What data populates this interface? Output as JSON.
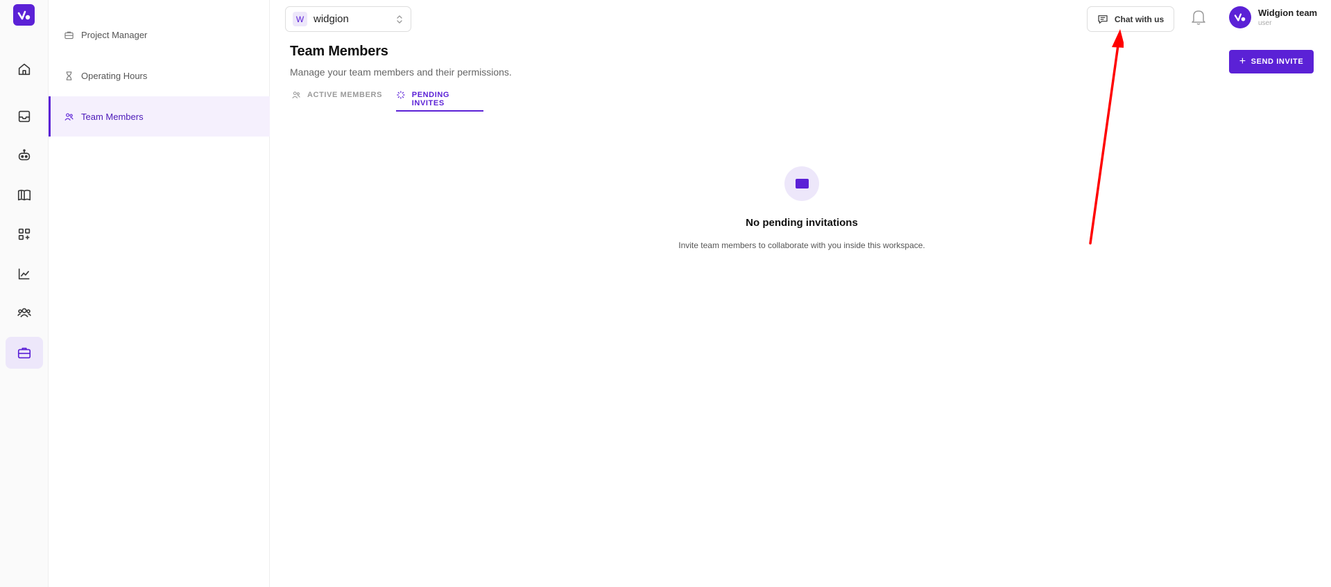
{
  "rail": {
    "items": [
      {
        "icon": "home-icon",
        "active": false
      },
      {
        "icon": "inbox-icon",
        "active": false
      },
      {
        "icon": "bot-icon",
        "active": false
      },
      {
        "icon": "book-icon",
        "active": false
      },
      {
        "icon": "apps-add-icon",
        "active": false
      },
      {
        "icon": "analytics-icon",
        "active": false
      },
      {
        "icon": "users-icon",
        "active": false
      },
      {
        "icon": "briefcase-icon",
        "active": true
      }
    ]
  },
  "sidebar": {
    "items": [
      {
        "label": "Project Manager",
        "icon": "briefcase-icon"
      },
      {
        "label": "Operating Hours",
        "icon": "hourglass-icon"
      },
      {
        "label": "Team Members",
        "icon": "users-icon",
        "active": true
      }
    ]
  },
  "workspace": {
    "badge": "W",
    "name": "widgion"
  },
  "header": {
    "chat_label": "Chat with us",
    "user_name": "Widgion team",
    "user_role": "user"
  },
  "main": {
    "title": "Team Members",
    "subtitle": "Manage your team members and their permissions.",
    "send_invite_label": "SEND INVITE",
    "tabs": [
      {
        "label": "ACTIVE MEMBERS",
        "active": false
      },
      {
        "label": "PENDING INVITES",
        "active": true
      }
    ],
    "empty_state": {
      "title": "No pending invitations",
      "subtitle": "Invite team members to collaborate with you inside this workspace."
    }
  },
  "colors": {
    "accent": "#5b21d6",
    "accent_light": "#ede7fa",
    "annotation": "#ff0000"
  }
}
